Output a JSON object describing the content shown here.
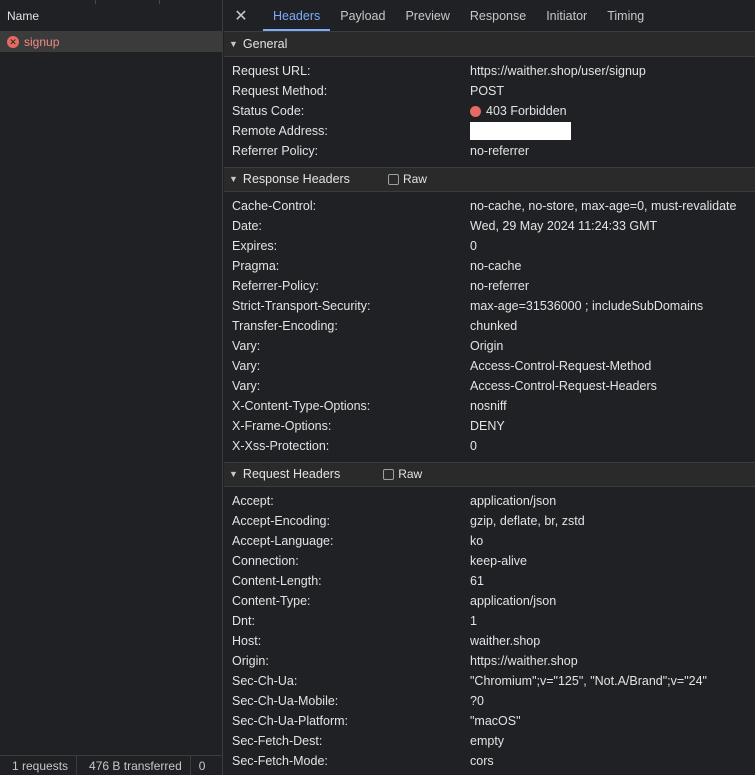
{
  "left": {
    "name_header": "Name",
    "requests": [
      {
        "name": "signup",
        "status_icon": "error-x-icon"
      }
    ],
    "footer": {
      "count": "1 requests",
      "transferred": "476 B transferred",
      "extra": "0"
    }
  },
  "tabs": {
    "close_icon": "close-icon",
    "items": [
      "Headers",
      "Payload",
      "Preview",
      "Response",
      "Initiator",
      "Timing"
    ],
    "active": "Headers"
  },
  "general": {
    "title": "General",
    "rows": [
      {
        "key": "Request URL:",
        "value": "https://waither.shop/user/signup"
      },
      {
        "key": "Request Method:",
        "value": "POST"
      },
      {
        "key": "Status Code:",
        "value": "403 Forbidden"
      },
      {
        "key": "Remote Address:",
        "value": ""
      },
      {
        "key": "Referrer Policy:",
        "value": "no-referrer"
      }
    ]
  },
  "response_headers": {
    "title": "Response Headers",
    "raw_label": "Raw",
    "rows": [
      {
        "key": "Cache-Control:",
        "value": "no-cache, no-store, max-age=0, must-revalidate"
      },
      {
        "key": "Date:",
        "value": "Wed, 29 May 2024 11:24:33 GMT"
      },
      {
        "key": "Expires:",
        "value": "0"
      },
      {
        "key": "Pragma:",
        "value": "no-cache"
      },
      {
        "key": "Referrer-Policy:",
        "value": "no-referrer"
      },
      {
        "key": "Strict-Transport-Security:",
        "value": "max-age=31536000 ; includeSubDomains"
      },
      {
        "key": "Transfer-Encoding:",
        "value": "chunked"
      },
      {
        "key": "Vary:",
        "value": "Origin"
      },
      {
        "key": "Vary:",
        "value": "Access-Control-Request-Method"
      },
      {
        "key": "Vary:",
        "value": "Access-Control-Request-Headers"
      },
      {
        "key": "X-Content-Type-Options:",
        "value": "nosniff"
      },
      {
        "key": "X-Frame-Options:",
        "value": "DENY"
      },
      {
        "key": "X-Xss-Protection:",
        "value": "0"
      }
    ]
  },
  "request_headers": {
    "title": "Request Headers",
    "raw_label": "Raw",
    "rows": [
      {
        "key": "Accept:",
        "value": "application/json"
      },
      {
        "key": "Accept-Encoding:",
        "value": "gzip, deflate, br, zstd"
      },
      {
        "key": "Accept-Language:",
        "value": "ko"
      },
      {
        "key": "Connection:",
        "value": "keep-alive"
      },
      {
        "key": "Content-Length:",
        "value": "61"
      },
      {
        "key": "Content-Type:",
        "value": "application/json"
      },
      {
        "key": "Dnt:",
        "value": "1"
      },
      {
        "key": "Host:",
        "value": "waither.shop"
      },
      {
        "key": "Origin:",
        "value": "https://waither.shop"
      },
      {
        "key": "Sec-Ch-Ua:",
        "value": "\"Chromium\";v=\"125\", \"Not.A/Brand\";v=\"24\""
      },
      {
        "key": "Sec-Ch-Ua-Mobile:",
        "value": "?0"
      },
      {
        "key": "Sec-Ch-Ua-Platform:",
        "value": "\"macOS\""
      },
      {
        "key": "Sec-Fetch-Dest:",
        "value": "empty"
      },
      {
        "key": "Sec-Fetch-Mode:",
        "value": "cors"
      }
    ]
  },
  "colors": {
    "accent": "#7cacf8",
    "error": "#e46a62",
    "error_text": "#f28b82"
  }
}
